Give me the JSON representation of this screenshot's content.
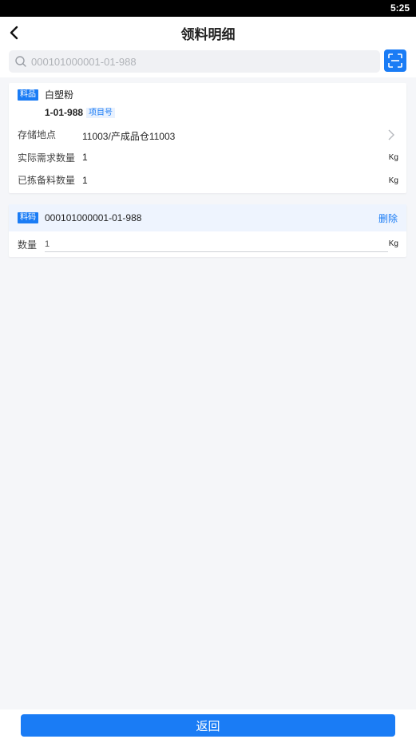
{
  "status_bar": {
    "time": "5:25"
  },
  "header": {
    "title": "领料明细",
    "back_icon": "chevron-left-icon"
  },
  "search": {
    "placeholder": "000101000001-01-988",
    "value": "",
    "scan_icon": "scan-icon"
  },
  "material": {
    "tag": "料品",
    "name": "白塑粉",
    "code": "1-01-988",
    "project_tag": "项目号",
    "rows": [
      {
        "label": "存储地点",
        "value": "11003/产成品仓11003",
        "unit": ""
      },
      {
        "label": "实际需求数量",
        "value": "1",
        "unit": "Kg"
      },
      {
        "label": "已拣备料数量",
        "value": "1",
        "unit": "Kg"
      }
    ]
  },
  "item_code": {
    "tag": "料码",
    "value": "000101000001-01-988",
    "delete_label": "删除",
    "qty_label": "数量",
    "qty_value": "1",
    "qty_unit": "Kg"
  },
  "footer": {
    "return_label": "返回"
  },
  "colors": {
    "accent": "#1a7cf5",
    "background": "#f5f6f9",
    "code_bar_bg": "#eef4fe"
  }
}
